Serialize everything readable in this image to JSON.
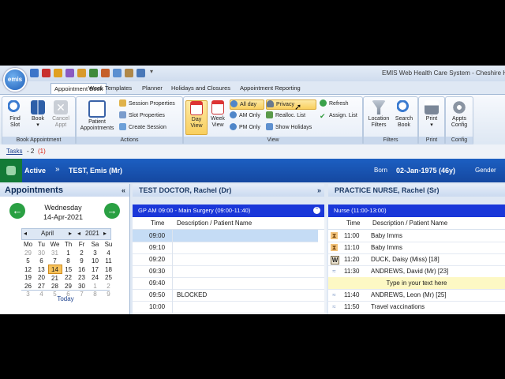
{
  "app": {
    "title": "EMIS Web Health Care System - Cheshire Hea",
    "logo_text": "emis"
  },
  "ribbon_tabs": [
    "Appointment Book",
    "Week Templates",
    "Planner",
    "Holidays and Closures",
    "Appointment Reporting"
  ],
  "groups": {
    "book_appointment": {
      "label": "Book Appointment",
      "find_slot": "Find Slot",
      "book": "Book",
      "cancel_appt": "Cancel Appt"
    },
    "actions": {
      "label": "Actions",
      "patient_appointments": "Patient Appointments",
      "session_properties": "Session Properties",
      "slot_properties": "Slot Properties",
      "create_session": "Create Session"
    },
    "view": {
      "label": "View",
      "day_view": "Day View",
      "week_view": "Week View",
      "all_day": "All day",
      "am_only": "AM Only",
      "pm_only": "PM Only",
      "privacy": "Privacy",
      "realloc_list": "Realloc. List",
      "show_holidays": "Show Holidays",
      "refresh": "Refresh",
      "assign_list": "Assign. List"
    },
    "filters": {
      "label": "Filters",
      "location_filters": "Location Filters",
      "search_book": "Search Book"
    },
    "print": {
      "label": "Print",
      "print": "Print"
    },
    "config": {
      "label": "Config",
      "appts_config": "Appts Config"
    }
  },
  "tasks": {
    "label": "Tasks",
    "separator": "- 2",
    "count": "(1)"
  },
  "patient": {
    "status": "Active",
    "name": "TEST, Emis (Mr)",
    "born_label": "Born",
    "dob": "02-Jan-1975 (46y)",
    "gender_label": "Gender"
  },
  "appointments_panel": {
    "title": "Appointments",
    "day": "Wednesday",
    "date": "14-Apr-2021",
    "month": "April",
    "year": "2021",
    "weekdays": [
      "Mo",
      "Tu",
      "We",
      "Th",
      "Fr",
      "Sa",
      "Su"
    ],
    "weeks": [
      [
        "29",
        "30",
        "31",
        "1",
        "2",
        "3",
        "4"
      ],
      [
        "5",
        "6",
        "7",
        "8",
        "9",
        "10",
        "11"
      ],
      [
        "12",
        "13",
        "14",
        "15",
        "16",
        "17",
        "18"
      ],
      [
        "19",
        "20",
        "21",
        "22",
        "23",
        "24",
        "25"
      ],
      [
        "26",
        "27",
        "28",
        "29",
        "30",
        "1",
        "2"
      ],
      [
        "3",
        "4",
        "5",
        "6",
        "7",
        "8",
        "9"
      ]
    ],
    "today_label": "Today"
  },
  "doctor_column": {
    "title": "TEST DOCTOR, Rachel (Dr)",
    "session": "GP AM 09:00 - Main Surgery (09:00-11:40)",
    "time_header": "Time",
    "desc_header": "Description / Patient Name",
    "rows": [
      {
        "time": "09:00",
        "desc": ""
      },
      {
        "time": "09:10",
        "desc": ""
      },
      {
        "time": "09:20",
        "desc": ""
      },
      {
        "time": "09:30",
        "desc": ""
      },
      {
        "time": "09:40",
        "desc": ""
      },
      {
        "time": "09:50",
        "desc": "BLOCKED"
      },
      {
        "time": "10:00",
        "desc": ""
      }
    ]
  },
  "nurse_column": {
    "title": "PRACTICE NURSE, Rachel (Sr)",
    "session": "Nurse (11:00-13:00)",
    "time_header": "Time",
    "desc_header": "Description / Patient Name",
    "rows": [
      {
        "icon": "hourglass-icon",
        "time": "11:00",
        "desc": "Baby Imms"
      },
      {
        "icon": "hourglass-icon",
        "time": "11:10",
        "desc": "Baby Imms"
      },
      {
        "icon": "waiting-w-icon",
        "time": "11:20",
        "desc": "DUCK, Daisy (Miss) [18]"
      },
      {
        "icon": "walking-icon",
        "time": "11:30",
        "desc": "ANDREWS, David (Mr) [23]"
      },
      {
        "icon": "",
        "time": "",
        "desc": "Type in your text here"
      },
      {
        "icon": "walking-icon",
        "time": "11:40",
        "desc": "ANDREWS, Leon (Mr) [25]"
      },
      {
        "icon": "walking-icon",
        "time": "11:50",
        "desc": "Travel vaccinations"
      }
    ]
  }
}
